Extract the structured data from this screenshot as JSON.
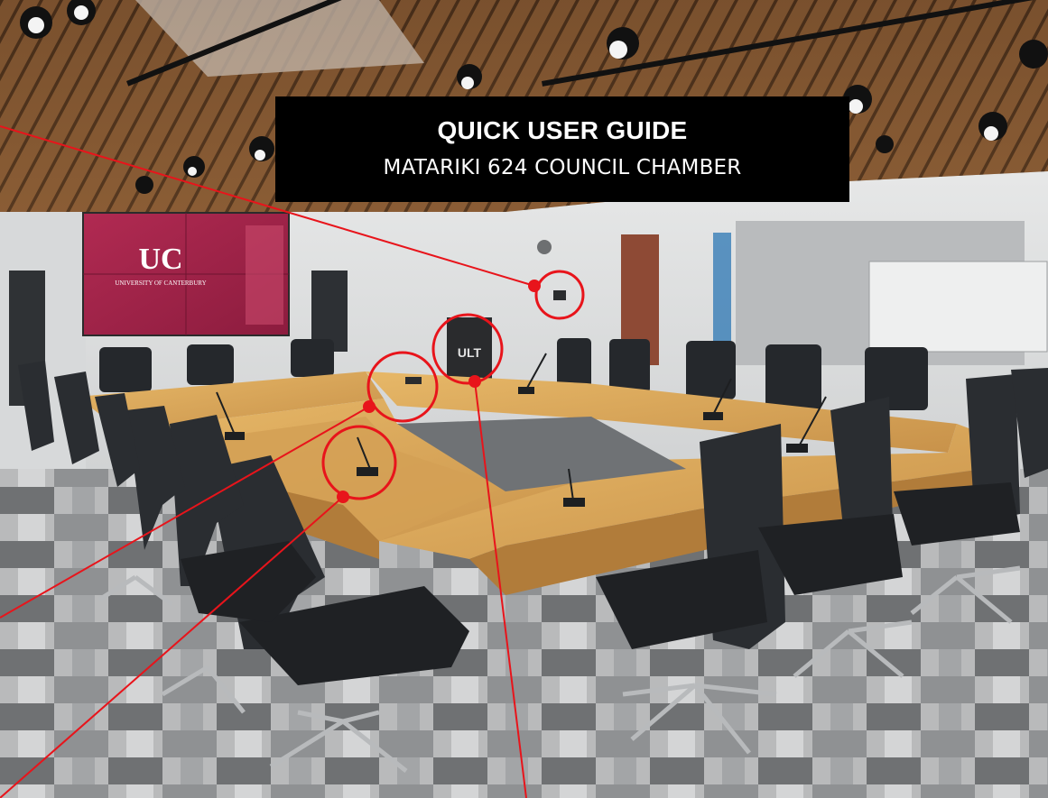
{
  "header": {
    "title": "QUICK USER GUIDE",
    "subtitle": "MATARIKI 624 COUNCIL CHAMBER"
  },
  "screen": {
    "logo": "UC",
    "wordmark": "UNIVERSITY OF CANTERBURY"
  },
  "lectern": {
    "logo": "ULT"
  },
  "callouts": [
    {
      "name": "wall-control-panel-callout",
      "target": "wall-control-panel"
    },
    {
      "name": "lectern-callout",
      "target": "lectern"
    },
    {
      "name": "table-control-callout",
      "target": "table-touch-panel"
    },
    {
      "name": "delegate-microphone-callout",
      "target": "delegate-microphone"
    }
  ],
  "colors": {
    "callout": "#e8141b",
    "title_background": "#000000",
    "title_text": "#ffffff",
    "screen": "#a3234a",
    "table": "#d9a655",
    "chair": "#2a2d31",
    "ceiling": "#7a4f2c"
  }
}
